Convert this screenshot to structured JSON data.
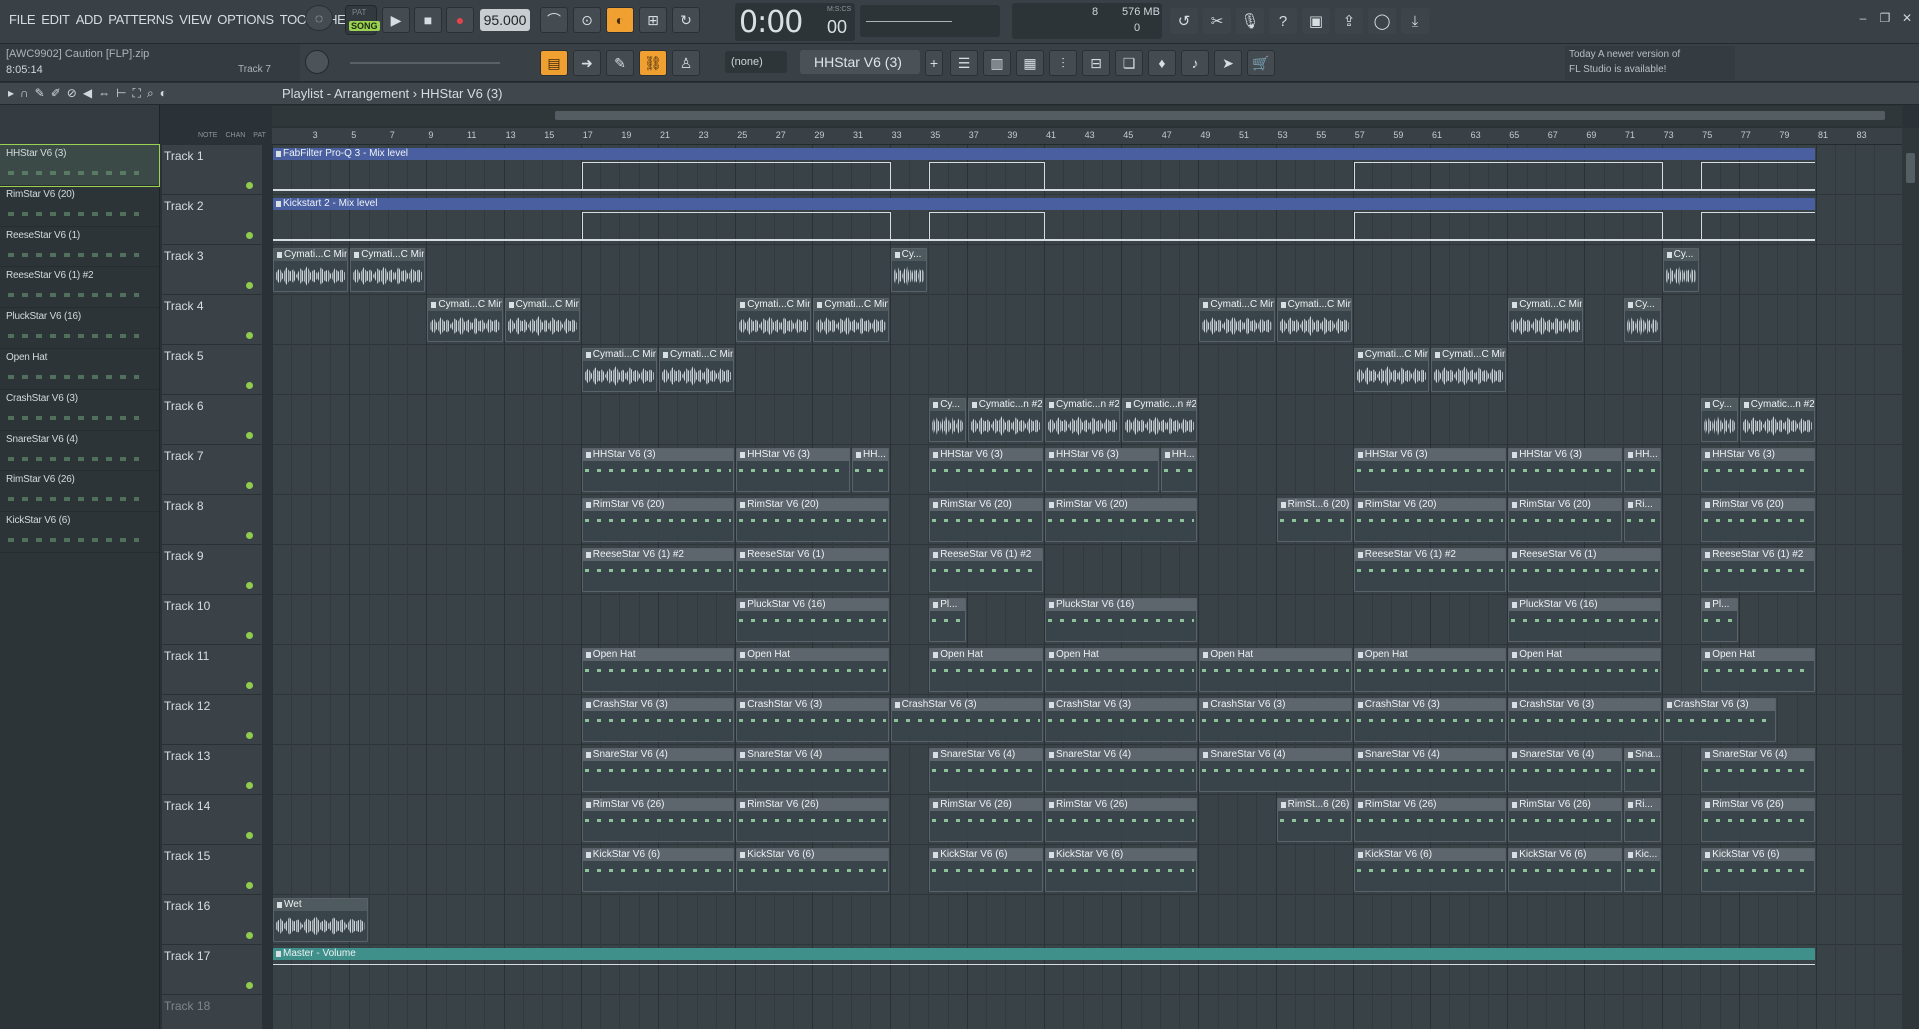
{
  "menu": [
    "FILE",
    "EDIT",
    "ADD",
    "PATTERNS",
    "VIEW",
    "OPTIONS",
    "TOOLS",
    "HELP"
  ],
  "project": {
    "file": "[AWC9902] Caution [FLP].zip",
    "time": "8:05:14",
    "hint_track": "Track 7"
  },
  "transport": {
    "song_label_top": "PAT",
    "song_label": "SONG",
    "tempo": "95.000",
    "time": "0:00",
    "time_frac": "00",
    "time_unit": "M:S:CS"
  },
  "monitor": {
    "cpu": "8",
    "mem": "576 MB",
    "poly": "0"
  },
  "pattern_selector": {
    "none": "(none)",
    "current": "HHStar V6 (3)"
  },
  "news": {
    "line1": "Today  A newer version of",
    "line2": "FL Studio is available!"
  },
  "playlist": {
    "title": "Playlist - Arrangement",
    "sep": "›",
    "pattern": "HHStar V6 (3)"
  },
  "left_header": {
    "note": "NOTE",
    "chan": "CHAN",
    "pat": "PAT"
  },
  "patterns": [
    {
      "name": "HHStar V6 (3)"
    },
    {
      "name": "RimStar V6 (20)"
    },
    {
      "name": "ReeseStar V6 (1)"
    },
    {
      "name": "ReeseStar V6 (1) #2"
    },
    {
      "name": "PluckStar V6 (16)"
    },
    {
      "name": "Open Hat"
    },
    {
      "name": "CrashStar V6 (3)"
    },
    {
      "name": "SnareStar V6 (4)"
    },
    {
      "name": "RimStar V6 (26)"
    },
    {
      "name": "KickStar V6 (6)"
    }
  ],
  "ruler": [
    "3",
    "5",
    "7",
    "9",
    "11",
    "13",
    "15",
    "17",
    "19",
    "21",
    "23",
    "25",
    "27",
    "29",
    "31",
    "33",
    "35",
    "37",
    "39",
    "41",
    "43",
    "45",
    "47",
    "49",
    "51",
    "53",
    "55",
    "57",
    "59",
    "61",
    "63",
    "65",
    "67",
    "69",
    "71",
    "73",
    "75",
    "77",
    "79",
    "81",
    "83"
  ],
  "tracks": [
    {
      "name": "Track 1"
    },
    {
      "name": "Track 2"
    },
    {
      "name": "Track 3"
    },
    {
      "name": "Track 4"
    },
    {
      "name": "Track 5"
    },
    {
      "name": "Track 6"
    },
    {
      "name": "Track 7"
    },
    {
      "name": "Track 8"
    },
    {
      "name": "Track 9"
    },
    {
      "name": "Track 10"
    },
    {
      "name": "Track 11"
    },
    {
      "name": "Track 12"
    },
    {
      "name": "Track 13"
    },
    {
      "name": "Track 14"
    },
    {
      "name": "Track 15"
    },
    {
      "name": "Track 16"
    },
    {
      "name": "Track 17"
    },
    {
      "name": "Track 18"
    }
  ],
  "clips": [
    {
      "track": 0,
      "bar": 1,
      "len": 80,
      "kind": "auto",
      "name": "FabFilter Pro-Q 3 - Mix level"
    },
    {
      "track": 1,
      "bar": 1,
      "len": 80,
      "kind": "auto",
      "name": "Kickstart 2 - Mix level"
    },
    {
      "track": 2,
      "bar": 1,
      "len": 4,
      "kind": "audio",
      "name": "Cymati...C Min"
    },
    {
      "track": 2,
      "bar": 5,
      "len": 4,
      "kind": "audio",
      "name": "Cymati...C Min"
    },
    {
      "track": 2,
      "bar": 33,
      "len": 2,
      "kind": "audio",
      "name": "Cy..."
    },
    {
      "track": 2,
      "bar": 73,
      "len": 2,
      "kind": "audio",
      "name": "Cy..."
    },
    {
      "track": 3,
      "bar": 9,
      "len": 4,
      "kind": "audio",
      "name": "Cymati...C Min"
    },
    {
      "track": 3,
      "bar": 13,
      "len": 4,
      "kind": "audio",
      "name": "Cymati...C Min"
    },
    {
      "track": 3,
      "bar": 25,
      "len": 4,
      "kind": "audio",
      "name": "Cymati...C Min"
    },
    {
      "track": 3,
      "bar": 29,
      "len": 4,
      "kind": "audio",
      "name": "Cymati...C Min"
    },
    {
      "track": 3,
      "bar": 49,
      "len": 4,
      "kind": "audio",
      "name": "Cymati...C Min"
    },
    {
      "track": 3,
      "bar": 53,
      "len": 4,
      "kind": "audio",
      "name": "Cymati...C Min"
    },
    {
      "track": 3,
      "bar": 65,
      "len": 4,
      "kind": "audio",
      "name": "Cymati...C Min"
    },
    {
      "track": 3,
      "bar": 71,
      "len": 2,
      "kind": "audio",
      "name": "Cy..."
    },
    {
      "track": 4,
      "bar": 17,
      "len": 4,
      "kind": "audio",
      "name": "Cymati...C Min"
    },
    {
      "track": 4,
      "bar": 21,
      "len": 4,
      "kind": "audio",
      "name": "Cymati...C Min"
    },
    {
      "track": 4,
      "bar": 57,
      "len": 4,
      "kind": "audio",
      "name": "Cymati...C Min"
    },
    {
      "track": 4,
      "bar": 61,
      "len": 4,
      "kind": "audio",
      "name": "Cymati...C Min"
    },
    {
      "track": 5,
      "bar": 35,
      "len": 2,
      "kind": "audio",
      "name": "Cy..."
    },
    {
      "track": 5,
      "bar": 37,
      "len": 4,
      "kind": "audio",
      "name": "Cymatic...n #2"
    },
    {
      "track": 5,
      "bar": 41,
      "len": 4,
      "kind": "audio",
      "name": "Cymatic...n #2"
    },
    {
      "track": 5,
      "bar": 45,
      "len": 4,
      "kind": "audio",
      "name": "Cymatic...n #2"
    },
    {
      "track": 5,
      "bar": 75,
      "len": 2,
      "kind": "audio",
      "name": "Cy..."
    },
    {
      "track": 5,
      "bar": 77,
      "len": 4,
      "kind": "audio",
      "name": "Cymatic...n #2"
    },
    {
      "track": 6,
      "bar": 17,
      "len": 8,
      "kind": "pat",
      "name": "HHStar V6 (3)"
    },
    {
      "track": 6,
      "bar": 25,
      "len": 6,
      "kind": "pat",
      "name": "HHStar V6 (3)"
    },
    {
      "track": 6,
      "bar": 31,
      "len": 2,
      "kind": "pat",
      "name": "HH..."
    },
    {
      "track": 6,
      "bar": 35,
      "len": 6,
      "kind": "pat",
      "name": "HHStar V6 (3)"
    },
    {
      "track": 6,
      "bar": 41,
      "len": 6,
      "kind": "pat",
      "name": "HHStar V6 (3)"
    },
    {
      "track": 6,
      "bar": 47,
      "len": 2,
      "kind": "pat",
      "name": "HH..."
    },
    {
      "track": 6,
      "bar": 57,
      "len": 8,
      "kind": "pat",
      "name": "HHStar V6 (3)"
    },
    {
      "track": 6,
      "bar": 65,
      "len": 6,
      "kind": "pat",
      "name": "HHStar V6 (3)"
    },
    {
      "track": 6,
      "bar": 71,
      "len": 2,
      "kind": "pat",
      "name": "HH..."
    },
    {
      "track": 6,
      "bar": 75,
      "len": 6,
      "kind": "pat",
      "name": "HHStar V6 (3)"
    },
    {
      "track": 7,
      "bar": 17,
      "len": 8,
      "kind": "pat",
      "name": "RimStar V6 (20)"
    },
    {
      "track": 7,
      "bar": 25,
      "len": 8,
      "kind": "pat",
      "name": "RimStar V6 (20)"
    },
    {
      "track": 7,
      "bar": 35,
      "len": 6,
      "kind": "pat",
      "name": "RimStar V6 (20)"
    },
    {
      "track": 7,
      "bar": 41,
      "len": 8,
      "kind": "pat",
      "name": "RimStar V6 (20)"
    },
    {
      "track": 7,
      "bar": 53,
      "len": 4,
      "kind": "pat",
      "name": "RimSt...6 (20)"
    },
    {
      "track": 7,
      "bar": 57,
      "len": 8,
      "kind": "pat",
      "name": "RimStar V6 (20)"
    },
    {
      "track": 7,
      "bar": 65,
      "len": 6,
      "kind": "pat",
      "name": "RimStar V6 (20)"
    },
    {
      "track": 7,
      "bar": 71,
      "len": 2,
      "kind": "pat",
      "name": "Ri..."
    },
    {
      "track": 7,
      "bar": 75,
      "len": 6,
      "kind": "pat",
      "name": "RimStar V6 (20)"
    },
    {
      "track": 8,
      "bar": 17,
      "len": 8,
      "kind": "pat",
      "name": "ReeseStar V6 (1) #2"
    },
    {
      "track": 8,
      "bar": 25,
      "len": 8,
      "kind": "pat",
      "name": "ReeseStar V6 (1)"
    },
    {
      "track": 8,
      "bar": 35,
      "len": 6,
      "kind": "pat",
      "name": "ReeseStar V6 (1) #2"
    },
    {
      "track": 8,
      "bar": 57,
      "len": 8,
      "kind": "pat",
      "name": "ReeseStar V6 (1) #2"
    },
    {
      "track": 8,
      "bar": 65,
      "len": 8,
      "kind": "pat",
      "name": "ReeseStar V6 (1)"
    },
    {
      "track": 8,
      "bar": 75,
      "len": 6,
      "kind": "pat",
      "name": "ReeseStar V6 (1) #2"
    },
    {
      "track": 9,
      "bar": 25,
      "len": 8,
      "kind": "pat",
      "name": "PluckStar V6 (16)"
    },
    {
      "track": 9,
      "bar": 35,
      "len": 2,
      "kind": "pat",
      "name": "Pl..."
    },
    {
      "track": 9,
      "bar": 41,
      "len": 8,
      "kind": "pat",
      "name": "PluckStar V6 (16)"
    },
    {
      "track": 9,
      "bar": 65,
      "len": 8,
      "kind": "pat",
      "name": "PluckStar V6 (16)"
    },
    {
      "track": 9,
      "bar": 75,
      "len": 2,
      "kind": "pat",
      "name": "Pl..."
    },
    {
      "track": 10,
      "bar": 17,
      "len": 8,
      "kind": "pat",
      "name": "Open Hat"
    },
    {
      "track": 10,
      "bar": 25,
      "len": 8,
      "kind": "pat",
      "name": "Open Hat"
    },
    {
      "track": 10,
      "bar": 35,
      "len": 6,
      "kind": "pat",
      "name": "Open Hat"
    },
    {
      "track": 10,
      "bar": 41,
      "len": 8,
      "kind": "pat",
      "name": "Open Hat"
    },
    {
      "track": 10,
      "bar": 49,
      "len": 8,
      "kind": "pat",
      "name": "Open Hat"
    },
    {
      "track": 10,
      "bar": 57,
      "len": 8,
      "kind": "pat",
      "name": "Open Hat"
    },
    {
      "track": 10,
      "bar": 65,
      "len": 8,
      "kind": "pat",
      "name": "Open Hat"
    },
    {
      "track": 10,
      "bar": 75,
      "len": 6,
      "kind": "pat",
      "name": "Open Hat"
    },
    {
      "track": 11,
      "bar": 17,
      "len": 8,
      "kind": "pat",
      "name": "CrashStar V6 (3)"
    },
    {
      "track": 11,
      "bar": 25,
      "len": 8,
      "kind": "pat",
      "name": "CrashStar V6 (3)"
    },
    {
      "track": 11,
      "bar": 33,
      "len": 8,
      "kind": "pat",
      "name": "CrashStar V6 (3)"
    },
    {
      "track": 11,
      "bar": 41,
      "len": 8,
      "kind": "pat",
      "name": "CrashStar V6 (3)"
    },
    {
      "track": 11,
      "bar": 49,
      "len": 8,
      "kind": "pat",
      "name": "CrashStar V6 (3)"
    },
    {
      "track": 11,
      "bar": 57,
      "len": 8,
      "kind": "pat",
      "name": "CrashStar V6 (3)"
    },
    {
      "track": 11,
      "bar": 65,
      "len": 8,
      "kind": "pat",
      "name": "CrashStar V6 (3)"
    },
    {
      "track": 11,
      "bar": 73,
      "len": 6,
      "kind": "pat",
      "name": "CrashStar V6 (3)"
    },
    {
      "track": 12,
      "bar": 17,
      "len": 8,
      "kind": "pat",
      "name": "SnareStar V6 (4)"
    },
    {
      "track": 12,
      "bar": 25,
      "len": 8,
      "kind": "pat",
      "name": "SnareStar V6 (4)"
    },
    {
      "track": 12,
      "bar": 35,
      "len": 6,
      "kind": "pat",
      "name": "SnareStar V6 (4)"
    },
    {
      "track": 12,
      "bar": 41,
      "len": 8,
      "kind": "pat",
      "name": "SnareStar V6 (4)"
    },
    {
      "track": 12,
      "bar": 49,
      "len": 8,
      "kind": "pat",
      "name": "SnareStar V6 (4)"
    },
    {
      "track": 12,
      "bar": 57,
      "len": 8,
      "kind": "pat",
      "name": "SnareStar V6 (4)"
    },
    {
      "track": 12,
      "bar": 65,
      "len": 6,
      "kind": "pat",
      "name": "SnareStar V6 (4)"
    },
    {
      "track": 12,
      "bar": 71,
      "len": 2,
      "kind": "pat",
      "name": "Sna..."
    },
    {
      "track": 12,
      "bar": 75,
      "len": 6,
      "kind": "pat",
      "name": "SnareStar V6 (4)"
    },
    {
      "track": 13,
      "bar": 17,
      "len": 8,
      "kind": "pat",
      "name": "RimStar V6 (26)"
    },
    {
      "track": 13,
      "bar": 25,
      "len": 8,
      "kind": "pat",
      "name": "RimStar V6 (26)"
    },
    {
      "track": 13,
      "bar": 35,
      "len": 6,
      "kind": "pat",
      "name": "RimStar V6 (26)"
    },
    {
      "track": 13,
      "bar": 41,
      "len": 8,
      "kind": "pat",
      "name": "RimStar V6 (26)"
    },
    {
      "track": 13,
      "bar": 53,
      "len": 4,
      "kind": "pat",
      "name": "RimSt...6 (26)"
    },
    {
      "track": 13,
      "bar": 57,
      "len": 8,
      "kind": "pat",
      "name": "RimStar V6 (26)"
    },
    {
      "track": 13,
      "bar": 65,
      "len": 6,
      "kind": "pat",
      "name": "RimStar V6 (26)"
    },
    {
      "track": 13,
      "bar": 71,
      "len": 2,
      "kind": "pat",
      "name": "Ri..."
    },
    {
      "track": 13,
      "bar": 75,
      "len": 6,
      "kind": "pat",
      "name": "RimStar V6 (26)"
    },
    {
      "track": 14,
      "bar": 17,
      "len": 8,
      "kind": "pat",
      "name": "KickStar V6 (6)"
    },
    {
      "track": 14,
      "bar": 25,
      "len": 8,
      "kind": "pat",
      "name": "KickStar V6 (6)"
    },
    {
      "track": 14,
      "bar": 35,
      "len": 6,
      "kind": "pat",
      "name": "KickStar V6 (6)"
    },
    {
      "track": 14,
      "bar": 41,
      "len": 8,
      "kind": "pat",
      "name": "KickStar V6 (6)"
    },
    {
      "track": 14,
      "bar": 57,
      "len": 8,
      "kind": "pat",
      "name": "KickStar V6 (6)"
    },
    {
      "track": 14,
      "bar": 65,
      "len": 6,
      "kind": "pat",
      "name": "KickStar V6 (6)"
    },
    {
      "track": 14,
      "bar": 71,
      "len": 2,
      "kind": "pat",
      "name": "Kic..."
    },
    {
      "track": 14,
      "bar": 75,
      "len": 6,
      "kind": "pat",
      "name": "KickStar V6 (6)"
    },
    {
      "track": 15,
      "bar": 1,
      "len": 5,
      "kind": "audio",
      "name": "Wet"
    },
    {
      "track": 16,
      "bar": 1,
      "len": 80,
      "kind": "autoteal",
      "name": "Master - Volume"
    }
  ]
}
